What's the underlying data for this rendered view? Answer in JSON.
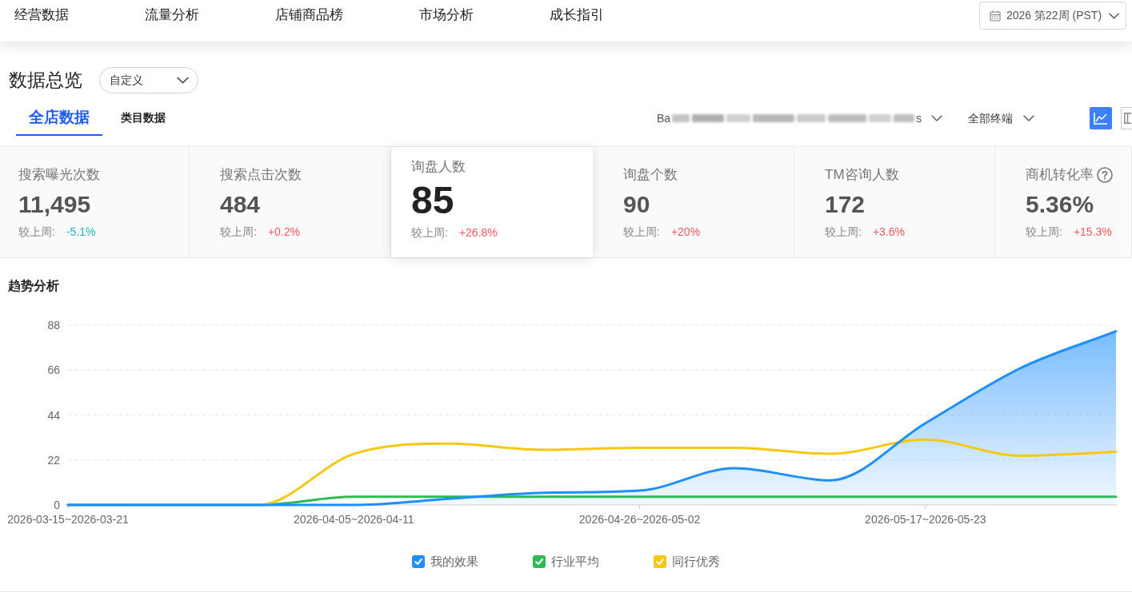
{
  "nav_items": [
    "经营数据",
    "流量分析",
    "店铺商品榜",
    "市场分析",
    "成长指引"
  ],
  "week_picker": {
    "value": "2026 第22周 (PST)"
  },
  "overview": {
    "title": "数据总览",
    "range_select": {
      "value": "自定义"
    }
  },
  "tabs": [
    {
      "label": "全店数据",
      "selected": true
    },
    {
      "label": "类目数据",
      "selected": false
    }
  ],
  "store_filter": {
    "visible_start": "Ba",
    "visible_end": "s"
  },
  "terminal_filter": {
    "value": "全部终端"
  },
  "view_buttons": [
    {
      "kind": "chart",
      "selected": true
    },
    {
      "kind": "columns",
      "selected": false
    }
  ],
  "metrics": [
    {
      "title": "搜索曝光次数",
      "value": "11,495",
      "compare_label": "较上周:",
      "change": "-5.1%",
      "color": "#1bb8c4",
      "info": false,
      "selected": false
    },
    {
      "title": "搜索点击次数",
      "value": "484",
      "compare_label": "较上周:",
      "change": "+0.2%",
      "color": "#f5555d",
      "info": false,
      "selected": false
    },
    {
      "title": "询盘人数",
      "value": "85",
      "compare_label": "较上周:",
      "change": "+26.8%",
      "color": "#f5555d",
      "info": false,
      "selected": true
    },
    {
      "title": "询盘个数",
      "value": "90",
      "compare_label": "较上周:",
      "change": "+20%",
      "color": "#f5555d",
      "info": false,
      "selected": false
    },
    {
      "title": "TM咨询人数",
      "value": "172",
      "compare_label": "较上周:",
      "change": "+3.6%",
      "color": "#f5555d",
      "info": false,
      "selected": false
    },
    {
      "title": "商机转化率",
      "value": "5.36%",
      "compare_label": "较上周:",
      "change": "+15.3%",
      "color": "#f5555d",
      "info": true,
      "selected": false
    }
  ],
  "trend": {
    "title": "趋势分析",
    "chart_data": {
      "type": "line",
      "categories": [
        "2026-03-15~2026-03-21",
        null,
        null,
        "2026-04-05~2026-04-11",
        null,
        null,
        "2026-04-26~2026-05-02",
        null,
        null,
        "2026-05-17~2026-05-23",
        null,
        null
      ],
      "ylim": [
        0,
        88
      ],
      "yticks": [
        0,
        22,
        44,
        66,
        88
      ],
      "grid": true,
      "series": [
        {
          "name": "我的效果",
          "color": "#1e8fff",
          "type": "area",
          "values": [
            0,
            0,
            0,
            0,
            3,
            6,
            7,
            18,
            12,
            40,
            67,
            85
          ]
        },
        {
          "name": "行业平均",
          "color": "#2dbb55",
          "type": "line",
          "values": [
            0,
            0,
            0,
            4,
            4,
            4,
            4,
            4,
            4,
            4,
            4,
            4
          ]
        },
        {
          "name": "同行优秀",
          "color": "#f8c811",
          "type": "line",
          "values": [
            0,
            0,
            0,
            25,
            30,
            27,
            28,
            28,
            25,
            32,
            24,
            26
          ]
        }
      ]
    },
    "legend": [
      {
        "checked": true
      },
      {
        "checked": true
      },
      {
        "checked": true
      }
    ]
  }
}
